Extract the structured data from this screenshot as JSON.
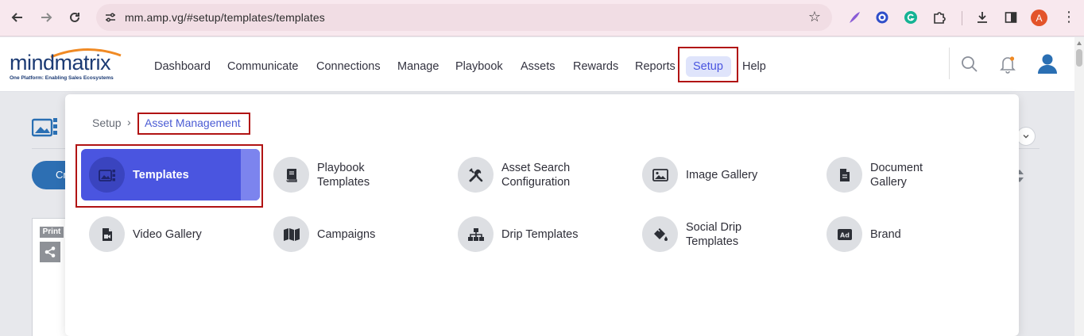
{
  "browser": {
    "url": "mm.amp.vg/#setup/templates/templates",
    "profile_initial": "A",
    "icons": [
      "back-arrow-icon",
      "forward-arrow-icon",
      "reload-icon",
      "site-settings-icon",
      "bookmark-star-icon",
      "quill-extension-icon",
      "target-extension-icon",
      "grammarly-extension-icon",
      "puzzle-extensions-icon",
      "download-icon",
      "sidepanel-icon",
      "more-menu-icon"
    ]
  },
  "app": {
    "logo_text": "mindmatrix",
    "logo_tagline": "One Platform: Enabling Sales Ecosystems",
    "nav": [
      "Dashboard",
      "Communicate",
      "Connections",
      "Manage",
      "Playbook",
      "Assets",
      "Rewards",
      "Reports",
      "Setup",
      "Help"
    ],
    "active_nav": "Setup",
    "header_icons": [
      "search-icon",
      "bell-icon",
      "user-icon"
    ]
  },
  "background_page": {
    "button_label_partial": "Cr",
    "print_label": "Print"
  },
  "dropdown": {
    "breadcrumb": {
      "root": "Setup",
      "separator": "›",
      "current": "Asset Management"
    },
    "tiles": [
      {
        "label": "Templates",
        "icon": "templates-icon",
        "active": true
      },
      {
        "label": "Playbook Templates",
        "icon": "book-icon",
        "active": false
      },
      {
        "label": "Asset Search Configuration",
        "icon": "tools-icon",
        "active": false
      },
      {
        "label": "Image Gallery",
        "icon": "image-icon",
        "active": false
      },
      {
        "label": "Document Gallery",
        "icon": "document-icon",
        "active": false
      },
      {
        "label": "Video Gallery",
        "icon": "video-file-icon",
        "active": false
      },
      {
        "label": "Campaigns",
        "icon": "map-icon",
        "active": false
      },
      {
        "label": "Drip Templates",
        "icon": "sitemap-icon",
        "active": false
      },
      {
        "label": "Social Drip Templates",
        "icon": "paint-bucket-icon",
        "active": false
      },
      {
        "label": "Brand",
        "icon": "ad-icon",
        "active": false
      }
    ]
  },
  "colors": {
    "accent": "#4a55e0",
    "highlight_box": "#b11313",
    "brand_navy": "#1c3b74",
    "logo_orange": "#f08a24"
  }
}
